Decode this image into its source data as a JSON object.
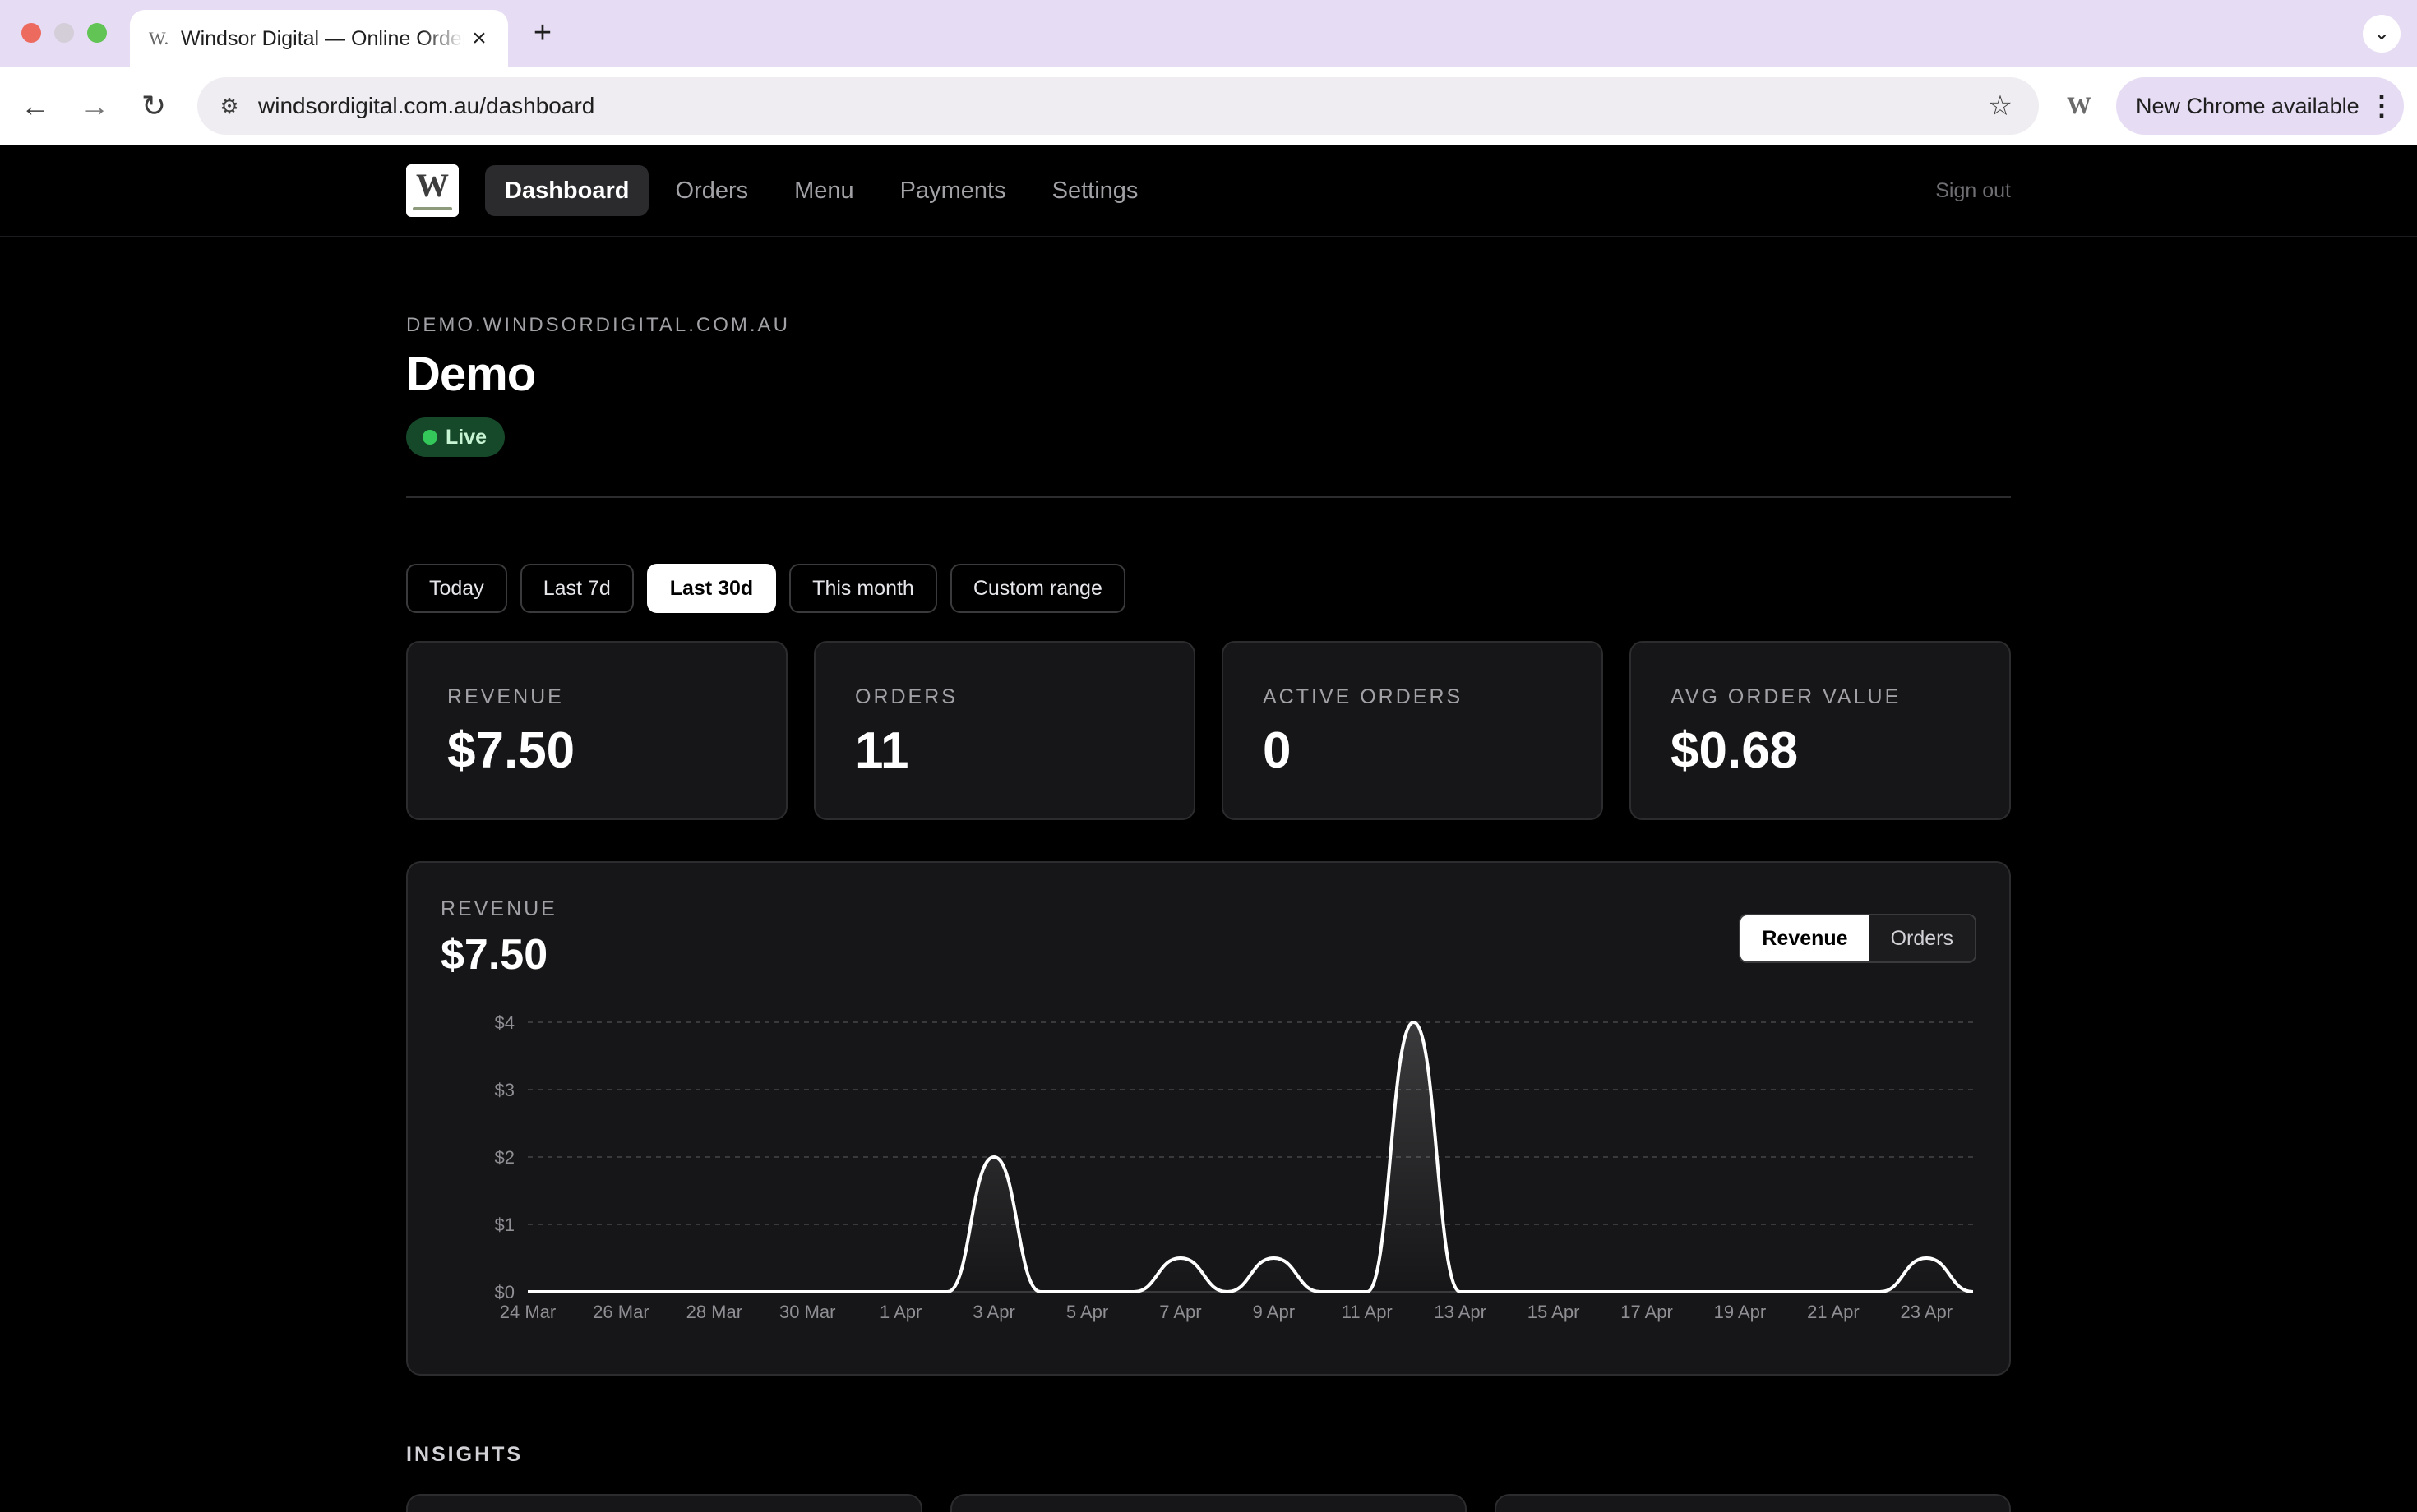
{
  "browser": {
    "tab_title": "Windsor Digital — Online Ordering",
    "favicon_glyph": "W.",
    "url": "windsordigital.com.au/dashboard",
    "extension_glyph": "W",
    "update_label": "New Chrome available"
  },
  "nav": {
    "logo_glyph": "W",
    "items": [
      "Dashboard",
      "Orders",
      "Menu",
      "Payments",
      "Settings"
    ],
    "active": "Dashboard",
    "signout": "Sign out"
  },
  "header": {
    "domain": "DEMO.WINDSORDIGITAL.COM.AU",
    "title": "Demo",
    "status": "Live",
    "status_color": "#34c759"
  },
  "ranges": {
    "items": [
      "Today",
      "Last 7d",
      "Last 30d",
      "This month",
      "Custom range"
    ],
    "active": "Last 30d"
  },
  "stats": [
    {
      "label": "REVENUE",
      "value": "$7.50"
    },
    {
      "label": "ORDERS",
      "value": "11"
    },
    {
      "label": "ACTIVE ORDERS",
      "value": "0"
    },
    {
      "label": "AVG ORDER VALUE",
      "value": "$0.68"
    }
  ],
  "chart_panel": {
    "label": "REVENUE",
    "total": "$7.50",
    "toggle": [
      "Revenue",
      "Orders"
    ],
    "toggle_active": "Revenue"
  },
  "insights": {
    "title": "INSIGHTS"
  },
  "chart_data": {
    "type": "area",
    "ylim": [
      0,
      4
    ],
    "y_ticks": [
      "$0",
      "$1",
      "$2",
      "$3",
      "$4"
    ],
    "x_tick_labels": [
      "24 Mar",
      "26 Mar",
      "28 Mar",
      "30 Mar",
      "1 Apr",
      "3 Apr",
      "5 Apr",
      "7 Apr",
      "9 Apr",
      "11 Apr",
      "13 Apr",
      "15 Apr",
      "17 Apr",
      "19 Apr",
      "21 Apr",
      "23 Apr"
    ],
    "categories": [
      "24 Mar",
      "25 Mar",
      "26 Mar",
      "27 Mar",
      "28 Mar",
      "29 Mar",
      "30 Mar",
      "31 Mar",
      "1 Apr",
      "2 Apr",
      "3 Apr",
      "4 Apr",
      "5 Apr",
      "6 Apr",
      "7 Apr",
      "8 Apr",
      "9 Apr",
      "10 Apr",
      "11 Apr",
      "12 Apr",
      "13 Apr",
      "14 Apr",
      "15 Apr",
      "16 Apr",
      "17 Apr",
      "18 Apr",
      "19 Apr",
      "20 Apr",
      "21 Apr",
      "22 Apr",
      "23 Apr",
      "24 Apr"
    ],
    "values": [
      0,
      0,
      0,
      0,
      0,
      0,
      0,
      0,
      0,
      0,
      2,
      0,
      0,
      0,
      0.5,
      0,
      0.5,
      0,
      0,
      4,
      0,
      0,
      0,
      0,
      0,
      0,
      0,
      0,
      0,
      0,
      0.5,
      0
    ],
    "xlabel": "",
    "ylabel": "",
    "grid": true,
    "line_color": "#ffffff"
  }
}
